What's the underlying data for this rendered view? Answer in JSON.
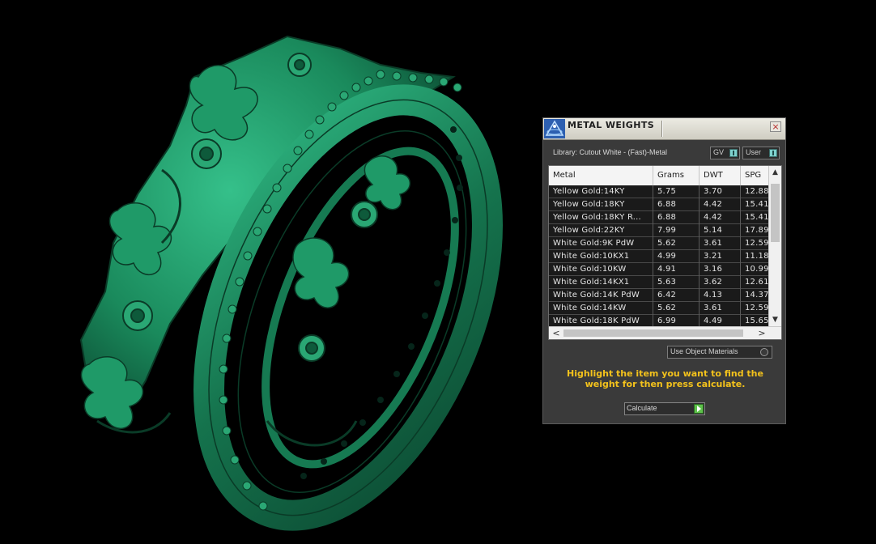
{
  "viewport": {
    "model": "crown-ring-3d-model",
    "color": "#1f9a68"
  },
  "panel": {
    "title": "METAL WEIGHTS",
    "close_glyph": "×",
    "library_label": "Library: Cutout White - (Fast)-Metal",
    "gv_label": "GV",
    "user_label": "User",
    "use_object_materials": "Use Object Materials",
    "hint": "Highlight the item you want to find the weight for then press calculate.",
    "calculate_label": "Calculate",
    "accent_color": "#f3c21c"
  },
  "table": {
    "columns": [
      "Metal",
      "Grams",
      "DWT",
      "SPG"
    ],
    "rows": [
      [
        "Yellow Gold:14KY",
        "5.75",
        "3.70",
        "12.88"
      ],
      [
        "Yellow Gold:18KY",
        "6.88",
        "4.42",
        "15.41"
      ],
      [
        "Yellow Gold:18KY R...",
        "6.88",
        "4.42",
        "15.41"
      ],
      [
        "Yellow Gold:22KY",
        "7.99",
        "5.14",
        "17.89"
      ],
      [
        "White Gold:9K PdW",
        "5.62",
        "3.61",
        "12.59"
      ],
      [
        "White Gold:10KX1",
        "4.99",
        "3.21",
        "11.18"
      ],
      [
        "White Gold:10KW",
        "4.91",
        "3.16",
        "10.99"
      ],
      [
        "White Gold:14KX1",
        "5.63",
        "3.62",
        "12.61"
      ],
      [
        "White Gold:14K PdW",
        "6.42",
        "4.13",
        "14.37"
      ],
      [
        "White Gold:14KW",
        "5.62",
        "3.61",
        "12.59"
      ],
      [
        "White Gold:18K PdW",
        "6.99",
        "4.49",
        "15.65"
      ]
    ],
    "scroll_up": "▲",
    "scroll_down": "▼",
    "scroll_left": "<",
    "scroll_right": ">"
  }
}
